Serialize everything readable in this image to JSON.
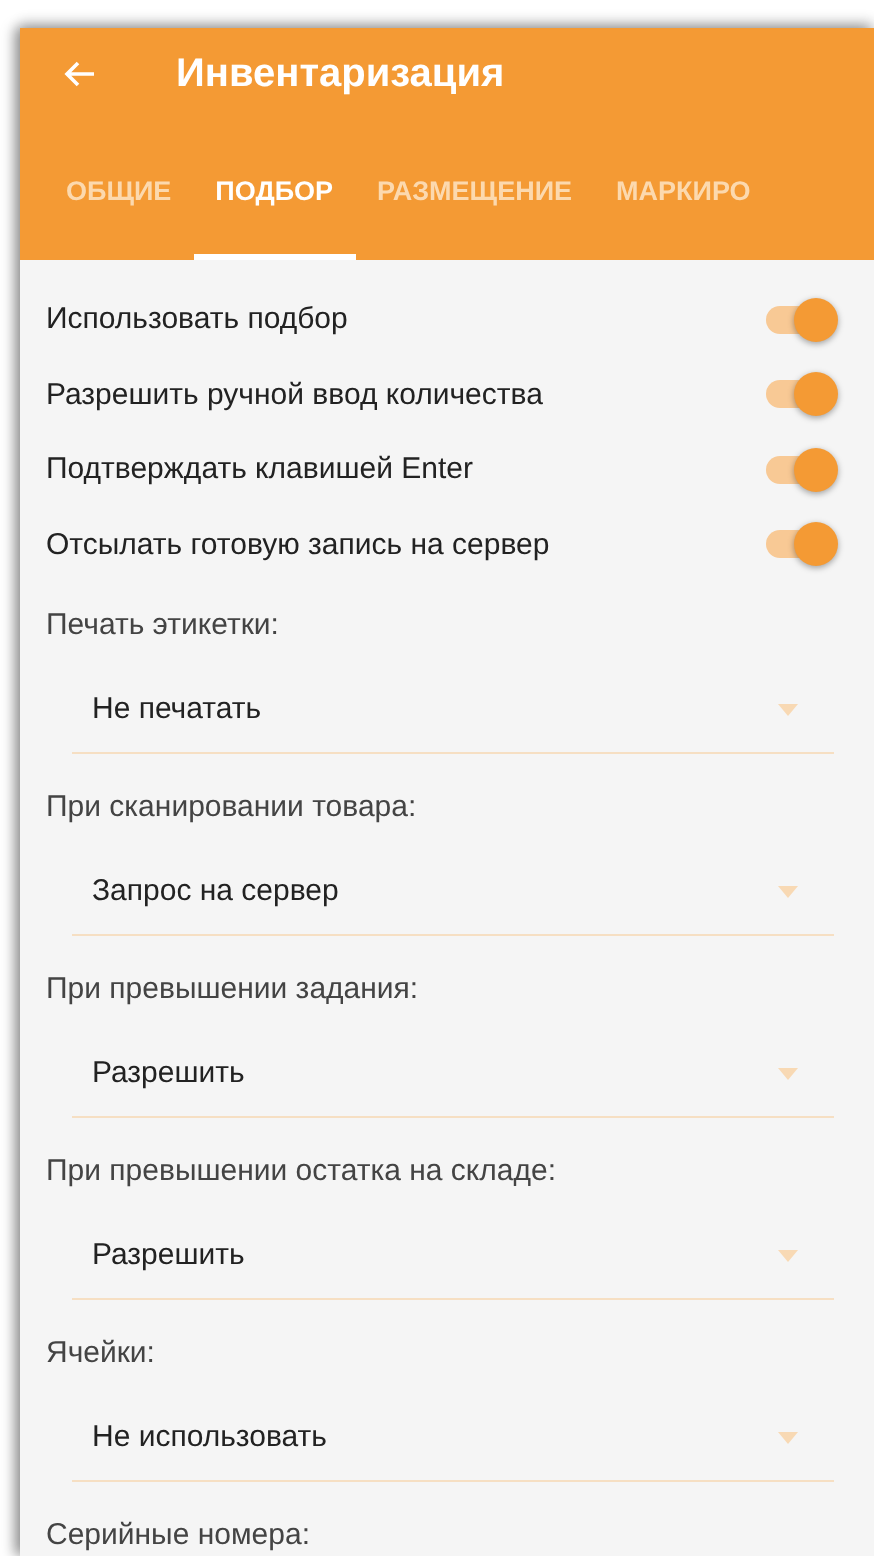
{
  "app_bar": {
    "title": "Инвентаризация"
  },
  "tabs": [
    {
      "label": "ОБЩИЕ",
      "selected": false
    },
    {
      "label": "ПОДБОР",
      "selected": true
    },
    {
      "label": "РАЗМЕЩЕНИЕ",
      "selected": false
    },
    {
      "label": "МАРКИРО",
      "selected": false
    }
  ],
  "toggles": [
    {
      "label": "Использовать подбор",
      "on": true
    },
    {
      "label": "Разрешить ручной ввод количества",
      "on": true
    },
    {
      "label": "Подтверждать клавишей Enter",
      "on": true
    },
    {
      "label": "Отсылать готовую запись на сервер",
      "on": true
    }
  ],
  "dropdowns": [
    {
      "label": "Печать этикетки:",
      "value": "Не печатать"
    },
    {
      "label": "При сканировании товара:",
      "value": "Запрос на сервер"
    },
    {
      "label": "При превышении задания:",
      "value": "Разрешить"
    },
    {
      "label": "При превышении остатка на складе:",
      "value": "Разрешить"
    },
    {
      "label": "Ячейки:",
      "value": "Не использовать"
    },
    {
      "label": "Серийные номера:"
    }
  ]
}
